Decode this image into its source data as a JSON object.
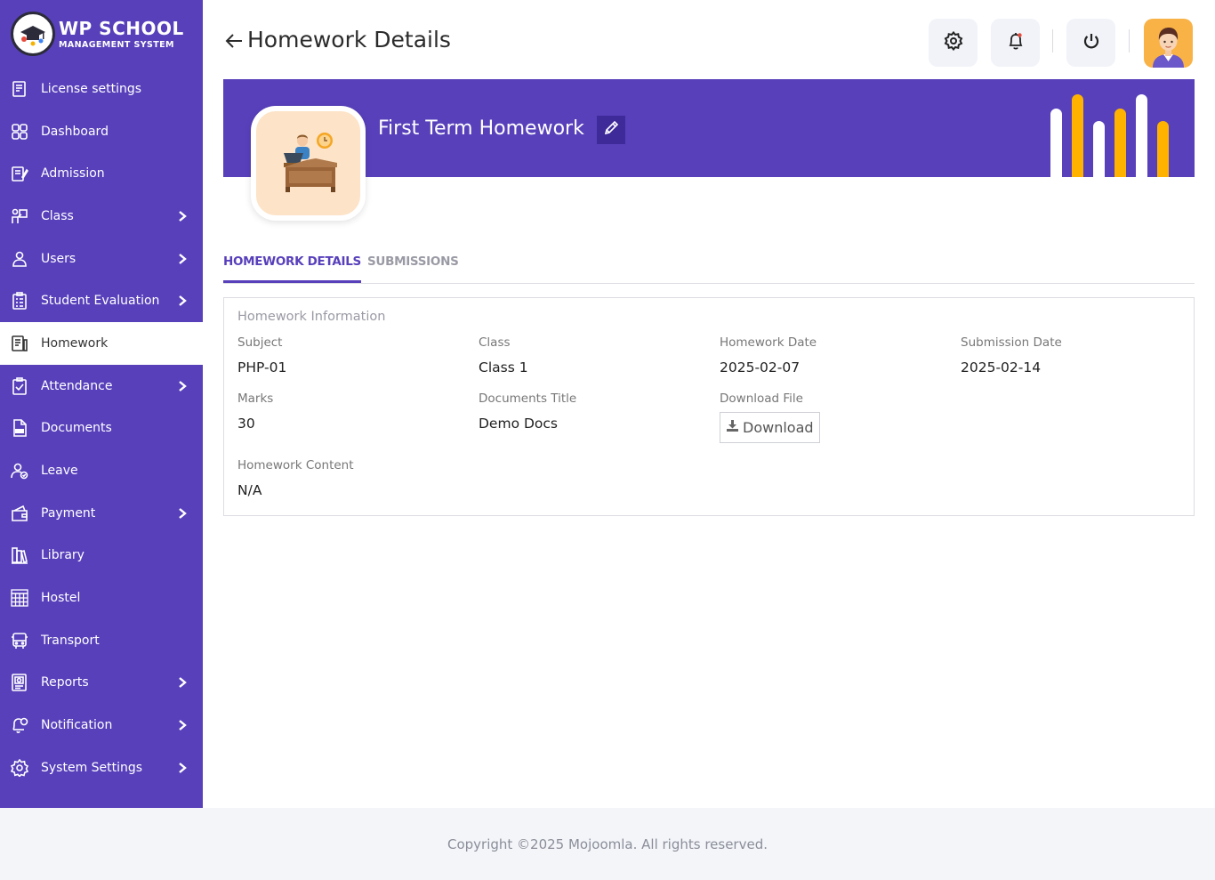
{
  "brand": {
    "title": "WP SCHOOL",
    "subtitle": "MANAGEMENT SYSTEM"
  },
  "sidebar": {
    "items": [
      {
        "label": "License settings",
        "icon": "license-icon",
        "chevron": false
      },
      {
        "label": "Dashboard",
        "icon": "dashboard-icon",
        "chevron": false
      },
      {
        "label": "Admission",
        "icon": "admission-icon",
        "chevron": false
      },
      {
        "label": "Class",
        "icon": "class-icon",
        "chevron": true
      },
      {
        "label": "Users",
        "icon": "users-icon",
        "chevron": true
      },
      {
        "label": "Student Evaluation",
        "icon": "evaluation-icon",
        "chevron": true
      },
      {
        "label": "Homework",
        "icon": "homework-icon",
        "chevron": false,
        "active": true
      },
      {
        "label": "Attendance",
        "icon": "attendance-icon",
        "chevron": true
      },
      {
        "label": "Documents",
        "icon": "documents-icon",
        "chevron": false
      },
      {
        "label": "Leave",
        "icon": "leave-icon",
        "chevron": false
      },
      {
        "label": "Payment",
        "icon": "payment-icon",
        "chevron": true
      },
      {
        "label": "Library",
        "icon": "library-icon",
        "chevron": false
      },
      {
        "label": "Hostel",
        "icon": "hostel-icon",
        "chevron": false
      },
      {
        "label": "Transport",
        "icon": "transport-icon",
        "chevron": false
      },
      {
        "label": "Reports",
        "icon": "reports-icon",
        "chevron": true
      },
      {
        "label": "Notification",
        "icon": "notification-icon",
        "chevron": true
      },
      {
        "label": "System Settings",
        "icon": "settings-icon",
        "chevron": true
      }
    ]
  },
  "header": {
    "title": "Homework Details",
    "buttons": [
      "settings-icon",
      "bell-icon",
      "power-icon"
    ]
  },
  "banner": {
    "title": "First Term Homework",
    "accent": "#5840bb",
    "bar_colors": [
      "#ffffff",
      "#ffb300"
    ]
  },
  "tabs": [
    {
      "label": "HOMEWORK DETAILS",
      "active": true
    },
    {
      "label": "SUBMISSIONS",
      "active": false
    }
  ],
  "info": {
    "title": "Homework Information",
    "subject_label": "Subject",
    "subject": "PHP-01",
    "class_label": "Class",
    "class": "Class 1",
    "homework_date_label": "Homework Date",
    "homework_date": "2025-02-07",
    "submission_date_label": "Submission Date",
    "submission_date": "2025-02-14",
    "marks_label": "Marks",
    "marks": "30",
    "doc_title_label": "Documents Title",
    "doc_title": "Demo Docs",
    "download_label": "Download File",
    "download_button": "Download",
    "content_label": "Homework Content",
    "content": "N/A"
  },
  "footer": {
    "text": "Copyright ©2025 Mojoomla. All rights reserved."
  }
}
